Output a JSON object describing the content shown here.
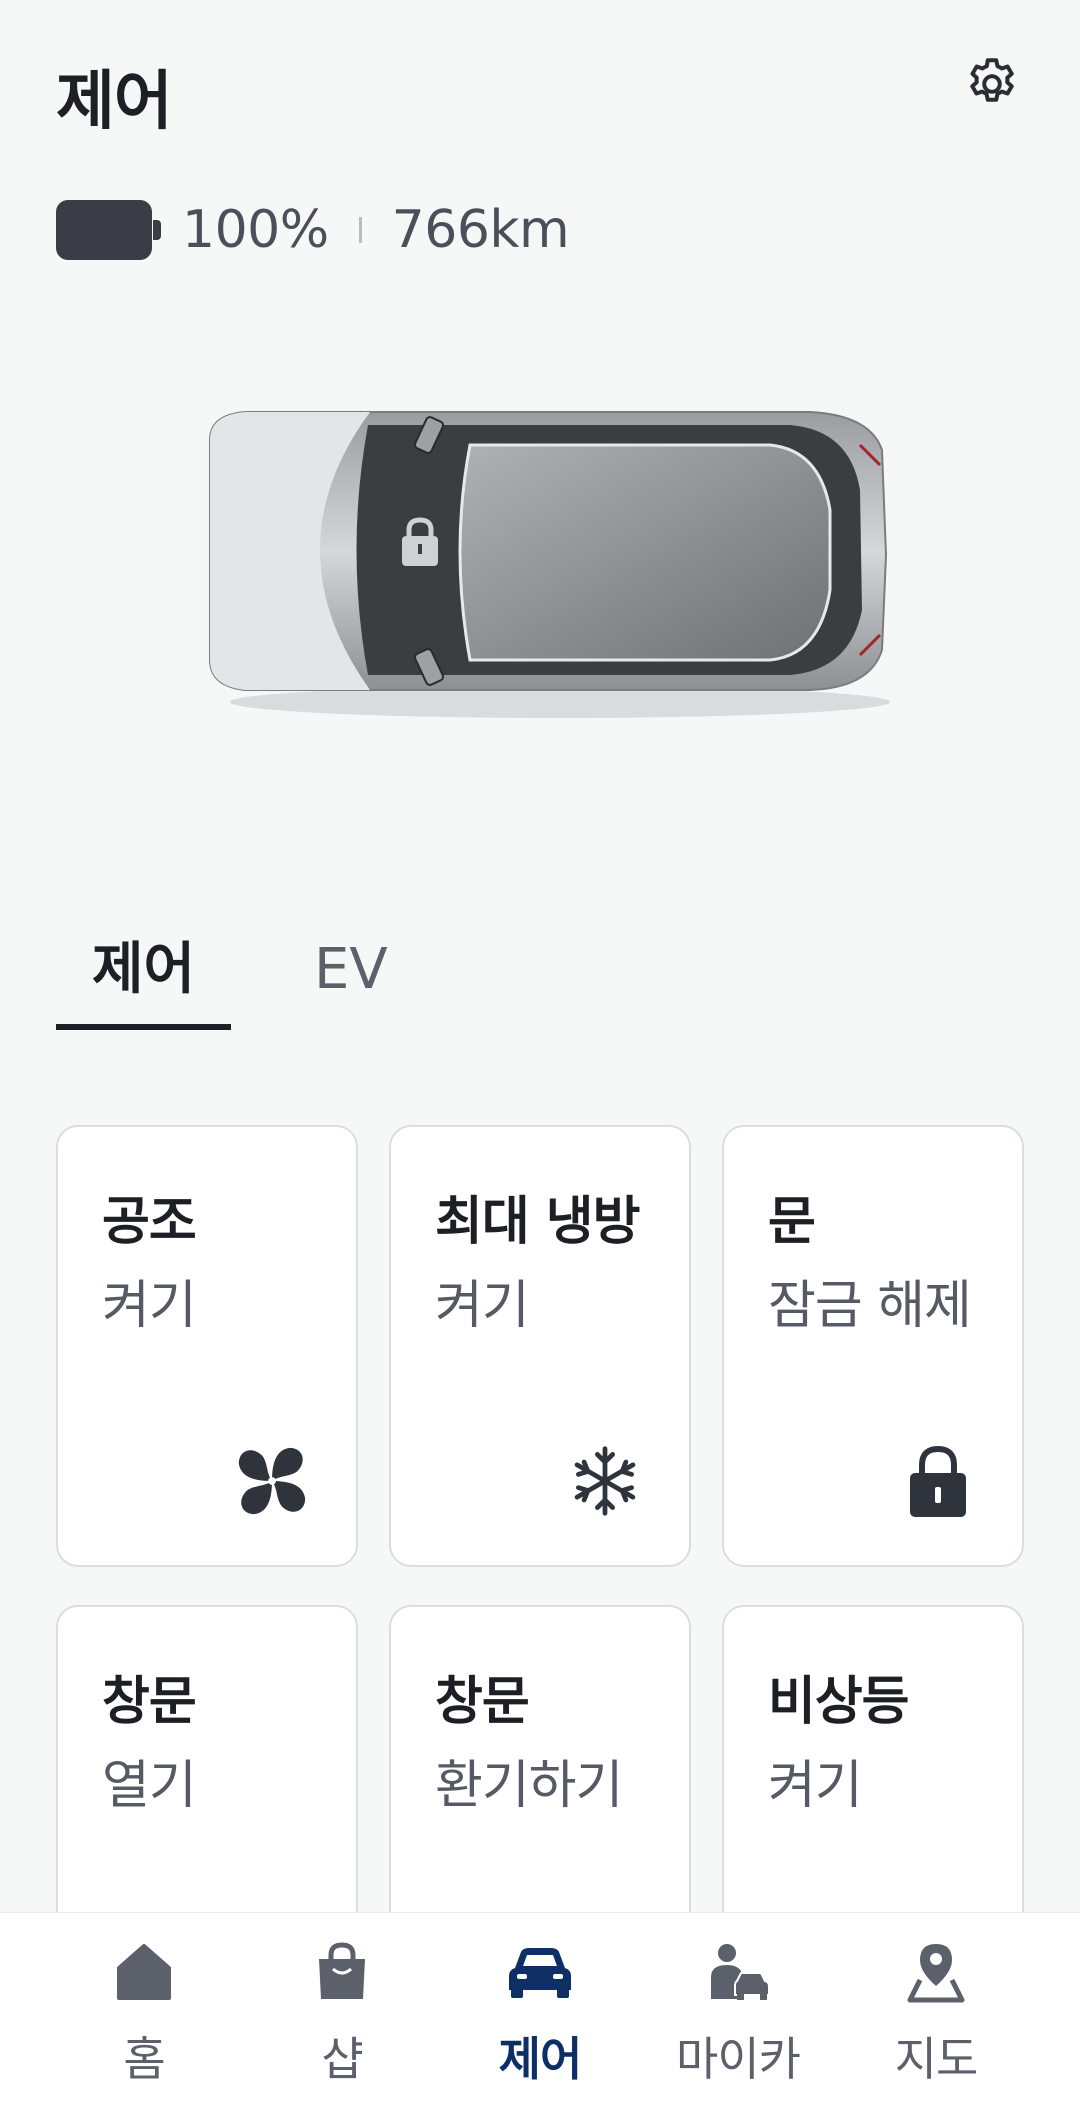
{
  "header": {
    "title": "제어"
  },
  "status": {
    "battery_percent": "100%",
    "range": "766km",
    "battery_level": 1.0
  },
  "tabs": [
    {
      "label": "제어",
      "active": true
    },
    {
      "label": "EV",
      "active": false
    }
  ],
  "controls": [
    {
      "title": "공조",
      "action": "켜기",
      "icon": "fan-icon"
    },
    {
      "title": "최대 냉방",
      "action": "켜기",
      "icon": "snowflake-icon"
    },
    {
      "title": "문",
      "action": "잠금 해제",
      "icon": "lock-icon"
    },
    {
      "title": "창문",
      "action": "열기",
      "icon": ""
    },
    {
      "title": "창문",
      "action": "환기하기",
      "icon": ""
    },
    {
      "title": "비상등",
      "action": "켜기",
      "icon": ""
    }
  ],
  "nav": [
    {
      "label": "홈",
      "icon": "home-icon"
    },
    {
      "label": "샵",
      "icon": "shop-bag-icon"
    },
    {
      "label": "제어",
      "icon": "car-icon",
      "active": true
    },
    {
      "label": "마이카",
      "icon": "mycar-icon"
    },
    {
      "label": "지도",
      "icon": "map-pin-icon"
    }
  ],
  "colors": {
    "accent": "#0d2f66",
    "background": "#f6f8f8",
    "icon": "#3a3d45"
  }
}
